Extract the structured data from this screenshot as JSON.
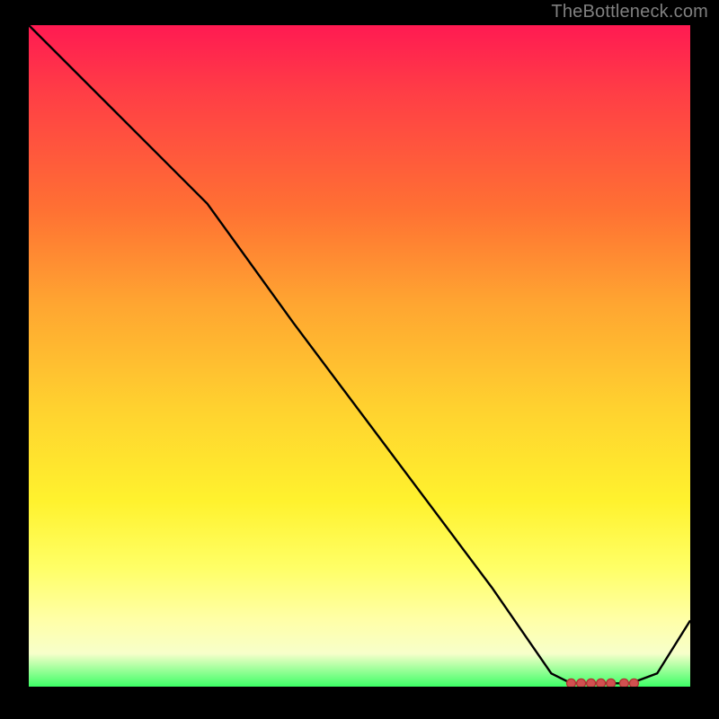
{
  "attribution": "TheBottleneck.com",
  "colors": {
    "marker_fill": "#d05050",
    "marker_stroke": "#b03030",
    "line": "#000000"
  },
  "chart_data": {
    "type": "line",
    "title": "",
    "xlabel": "",
    "ylabel": "",
    "xlim": [
      0,
      100
    ],
    "ylim": [
      0,
      100
    ],
    "grid": false,
    "legend": false,
    "series": [
      {
        "name": "bottleneck-curve",
        "x": [
          0,
          10,
          20,
          27,
          40,
          55,
          70,
          79,
          82,
          85,
          88,
          91,
          95,
          100
        ],
        "y": [
          100,
          90,
          80,
          73,
          55,
          35,
          15,
          2,
          0.5,
          0.5,
          0.5,
          0.5,
          2,
          10
        ]
      }
    ],
    "markers": {
      "series": "bottleneck-curve",
      "points": [
        {
          "x": 82,
          "y": 0.5
        },
        {
          "x": 83.5,
          "y": 0.5
        },
        {
          "x": 85,
          "y": 0.5
        },
        {
          "x": 86.5,
          "y": 0.5
        },
        {
          "x": 88,
          "y": 0.5
        },
        {
          "x": 90,
          "y": 0.5
        },
        {
          "x": 91.5,
          "y": 0.5
        }
      ],
      "radius": 5
    }
  }
}
